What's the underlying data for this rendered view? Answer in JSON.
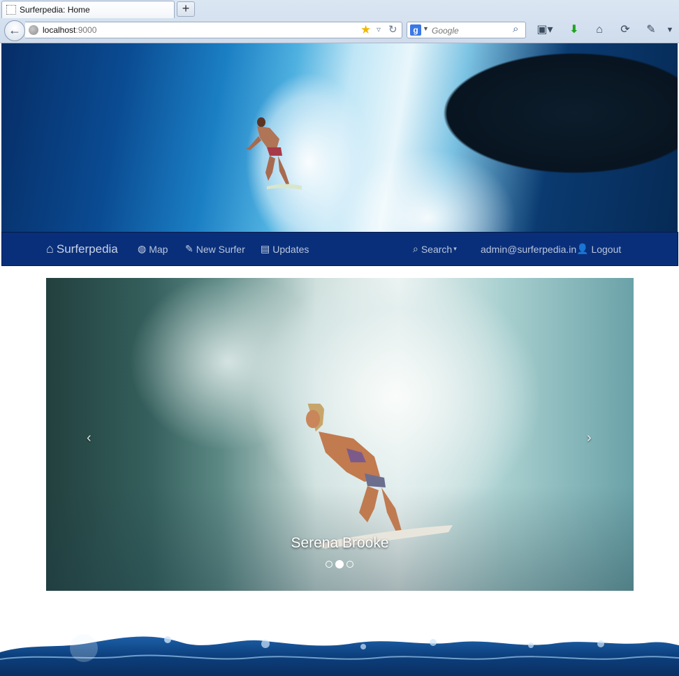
{
  "browser": {
    "tab_title": "Surferpedia: Home",
    "new_tab_label": "+",
    "url_host": "localhost",
    "url_port": ":9000",
    "search_placeholder": "Google",
    "toolbar_icons": [
      "bookmarks-icon",
      "download-icon",
      "home-icon",
      "sync-icon",
      "tools-icon"
    ]
  },
  "navbar": {
    "brand": "Surferpedia",
    "items": [
      {
        "label": "Map",
        "icon": "globe-icon"
      },
      {
        "label": "New Surfer",
        "icon": "pencil-icon"
      },
      {
        "label": "Updates",
        "icon": "list-icon"
      }
    ],
    "search": {
      "label": "Search",
      "icon": "search-icon"
    },
    "user_email": "admin@surferpedia.in",
    "logout": {
      "label": "Logout",
      "icon": "user-icon"
    }
  },
  "carousel": {
    "caption": "Serena Brooke",
    "prev": "‹",
    "next": "›",
    "slides_count": 3,
    "active_index": 1
  },
  "colors": {
    "navbar_bg": "#0a2f7a",
    "navbar_text": "#b9c6dd"
  }
}
